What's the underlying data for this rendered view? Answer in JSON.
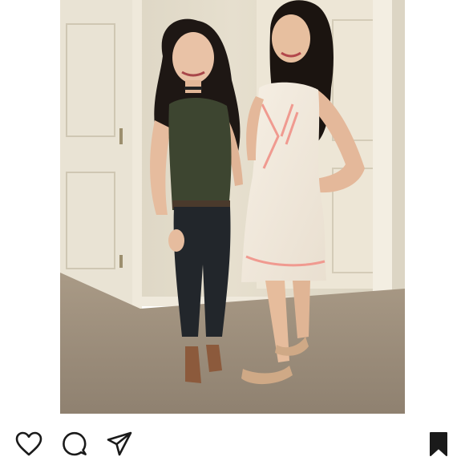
{
  "post": {
    "image": {
      "subject": "photo"
    }
  },
  "actions": {
    "icons": [
      "heart-icon",
      "comment-icon",
      "share-icon",
      "bookmark-icon"
    ]
  },
  "colors": {
    "background": "#ffffff",
    "icon": "#1a1a1a"
  }
}
